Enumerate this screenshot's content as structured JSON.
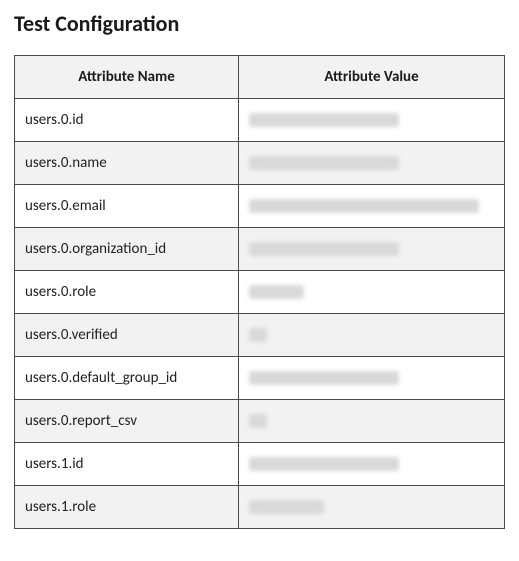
{
  "title": "Test Configuration",
  "table": {
    "headers": {
      "name": "Attribute Name",
      "value": "Attribute Value"
    },
    "rows": [
      {
        "name": "users.0.id",
        "value_redacted": true,
        "redact_width": 150
      },
      {
        "name": "users.0.name",
        "value_redacted": true,
        "redact_width": 150
      },
      {
        "name": "users.0.email",
        "value_redacted": true,
        "redact_width": 230
      },
      {
        "name": "users.0.organization_id",
        "value_redacted": true,
        "redact_width": 150
      },
      {
        "name": "users.0.role",
        "value_redacted": true,
        "redact_width": 55
      },
      {
        "name": "users.0.verified",
        "value_redacted": true,
        "redact_width": 18
      },
      {
        "name": "users.0.default_group_id",
        "value_redacted": true,
        "redact_width": 150
      },
      {
        "name": "users.0.report_csv",
        "value_redacted": true,
        "redact_width": 18
      },
      {
        "name": "users.1.id",
        "value_redacted": true,
        "redact_width": 150
      },
      {
        "name": "users.1.role",
        "value_redacted": true,
        "redact_width": 75
      }
    ]
  }
}
